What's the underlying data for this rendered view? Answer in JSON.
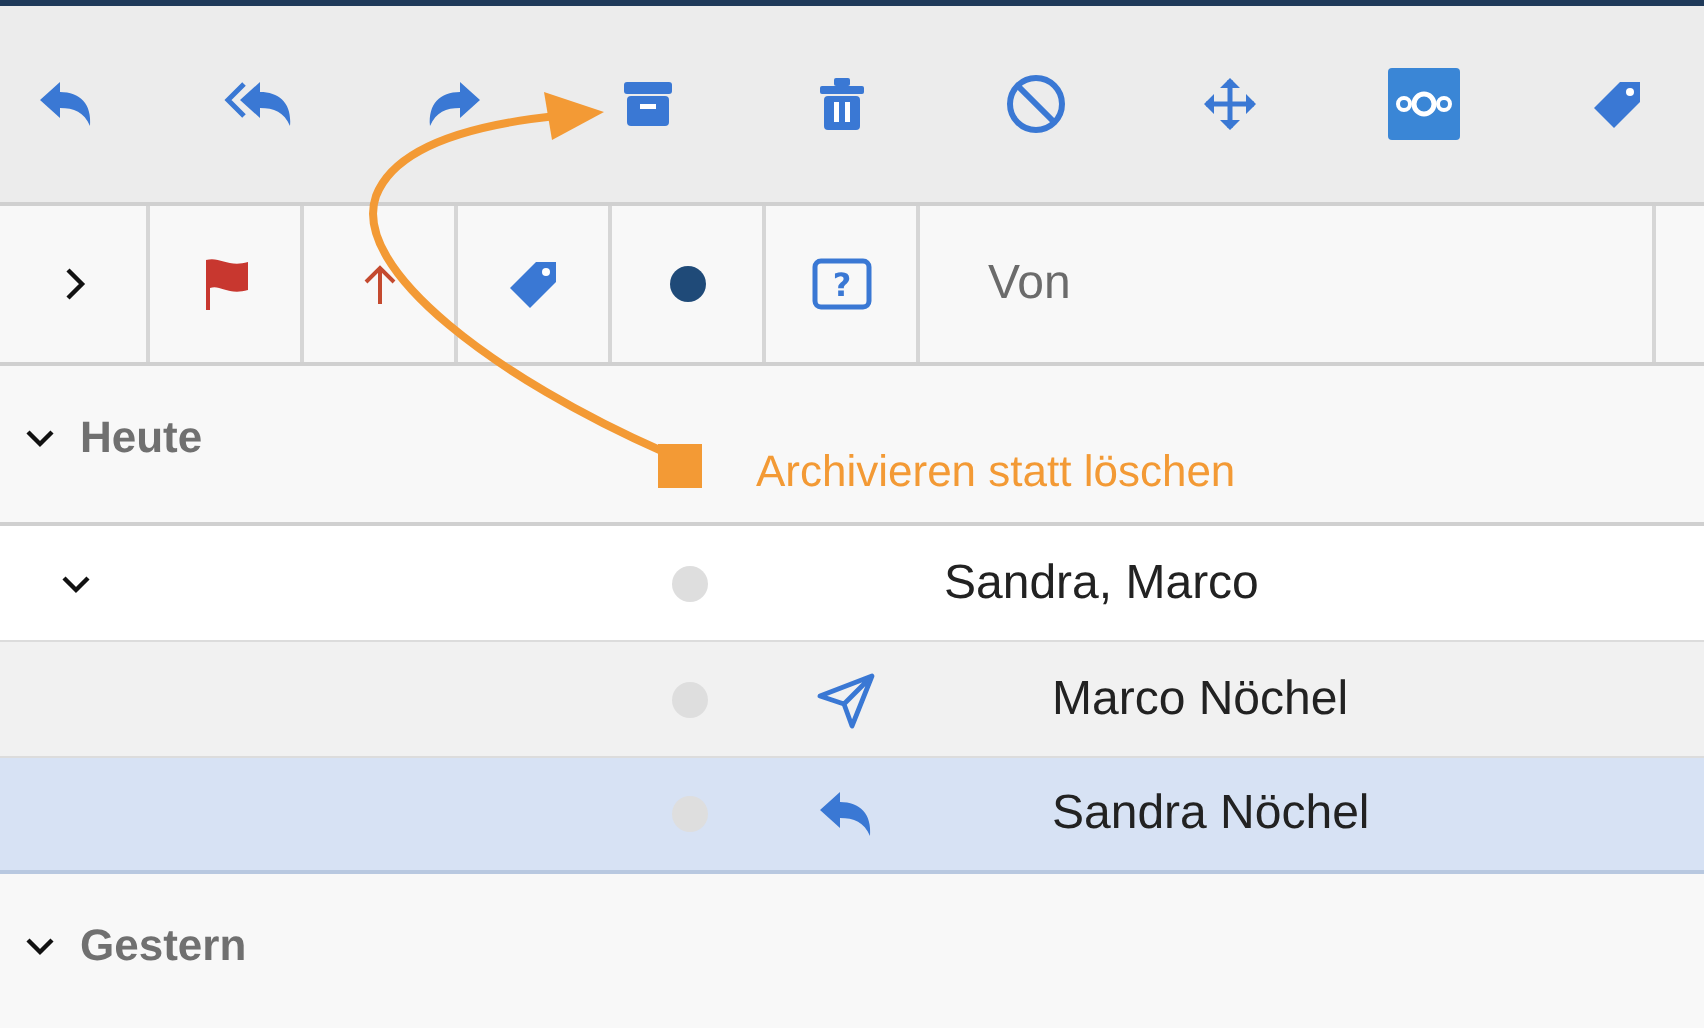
{
  "toolbar": [
    {
      "kind": "reply"
    },
    {
      "kind": "reply-all"
    },
    {
      "kind": "forward"
    },
    {
      "kind": "archive"
    },
    {
      "kind": "delete"
    },
    {
      "kind": "junk"
    },
    {
      "kind": "move"
    },
    {
      "kind": "app"
    },
    {
      "kind": "tag"
    }
  ],
  "columns": [
    {
      "kind": "thread"
    },
    {
      "kind": "flag"
    },
    {
      "kind": "priority"
    },
    {
      "kind": "tag"
    },
    {
      "kind": "unread"
    },
    {
      "kind": "status",
      "glyph": "?"
    },
    {
      "kind": "text",
      "label": "Von"
    }
  ],
  "groups": [
    {
      "label": "Heute",
      "expanded": true,
      "threads": [
        {
          "sender": "Sandra, Marco",
          "expanded": true,
          "selected": false,
          "children": [
            {
              "sender": "Marco Nöchel",
              "kind": "sent",
              "selected": false
            },
            {
              "sender": "Sandra Nöchel",
              "kind": "replied",
              "selected": true
            }
          ]
        }
      ]
    },
    {
      "label": "Gestern",
      "expanded": true
    }
  ],
  "annotation": {
    "text": "Archivieren statt löschen"
  }
}
